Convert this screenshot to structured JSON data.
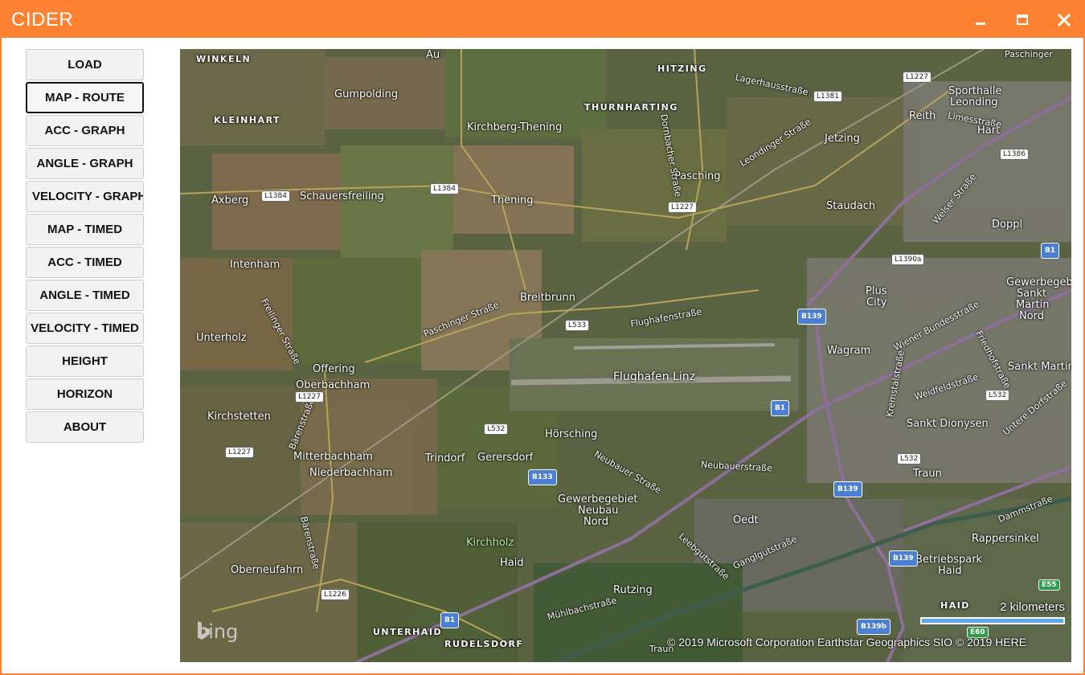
{
  "window": {
    "title": "CIDER",
    "accent": "#ff8232",
    "minimize_icon": "minimize-icon",
    "maximize_icon": "maximize-icon",
    "close_icon": "close-icon"
  },
  "sidebar": {
    "items": [
      {
        "label": "LOAD"
      },
      {
        "label": "MAP - ROUTE",
        "active": true
      },
      {
        "label": "ACC - GRAPH"
      },
      {
        "label": "ANGLE - GRAPH"
      },
      {
        "label": "VELOCITY - GRAPH"
      },
      {
        "label": "MAP - TIMED"
      },
      {
        "label": "ACC - TIMED"
      },
      {
        "label": "ANGLE - TIMED"
      },
      {
        "label": "VELOCITY - TIMED"
      },
      {
        "label": "HEIGHT"
      },
      {
        "label": "HORIZON"
      },
      {
        "label": "ABOUT"
      }
    ]
  },
  "map": {
    "places": {
      "winkeln": "WINKELN",
      "au": "Au",
      "hitzing": "HITZING",
      "paschinger": "Paschinger",
      "gumpolding": "Gumpolding",
      "thurnharting": "THURNHARTING",
      "sporthalle": "Sporthalle",
      "leonding": "Leonding",
      "kleinhart": "KLEINHART",
      "kirchberg": "Kirchberg-Thening",
      "reith": "Reith",
      "hart": "Hart",
      "jetzing": "Jetzing",
      "pasching": "Pasching",
      "axberg": "Axberg",
      "schauersfreiling": "Schauersfreiling",
      "thening": "Thening",
      "staudach": "Staudach",
      "doppl": "Doppl",
      "intenham": "Intenham",
      "plus_city_1": "Plus",
      "plus_city_2": "City",
      "gewerbe1": "Gewerbegebiet",
      "gewerbe2": "Sankt",
      "gewerbe3": "Martin",
      "gewerbe4": "Nord",
      "breitbrunn": "Breitbrunn",
      "unterholz": "Unterholz",
      "wagram": "Wagram",
      "flughafen": "Flughafen Linz",
      "sankt_martin": "Sankt Martin",
      "offering": "Offering",
      "oberbachham": "Oberbachham",
      "kirchstetten": "Kirchstetten",
      "sankt_dionysen": "Sankt Dionysen",
      "horsching": "Hörsching",
      "mitterbachham": "Mitterbachham",
      "niederbachham": "Niederbachham",
      "trindorf": "Trindorf",
      "gerersdorf": "Gerersdorf",
      "traun": "Traun",
      "gewerbe_neubau1": "Gewerbegebiet",
      "gewerbe_neubau2": "Neubau",
      "gewerbe_neubau3": "Nord",
      "oedt": "Oedt",
      "kirchholz": "Kirchholz",
      "rappersinkel": "Rappersinkel",
      "haid": "Haid",
      "betriebspark1": "Betriebspark",
      "betriebspark2": "Haid",
      "oberneufahrn": "Oberneufahrn",
      "rutzing": "Rutzing",
      "haid_caps": "HAID",
      "unterhaid": "UNTERHAID",
      "rudelsdorf": "RUDELSDORF",
      "traun_river": "Traun"
    },
    "streets": {
      "lagerhaus": "Lagerhausstraße",
      "leondinger": "Leondinger Straße",
      "dornbacher": "Dornbacher Straße",
      "limesstrasse": "Limesstraße",
      "welser": "Welser Straße",
      "paschinger_str": "Paschinger Straße",
      "flughafenstrasse": "Flughafenstraße",
      "freilinger": "Freilinger Straße",
      "wiener": "Wiener Bundesstraße",
      "friedhof": "Friedhofstraße",
      "kremstal": "Kremstalstraße",
      "weidfeld": "Weidfeldstraße",
      "untere_dorf": "Untere Dorfstraße",
      "baerenstrasse": "Bärenstraße",
      "neubauer": "Neubauer Straße",
      "neubauerstrasse": "Neubauerstraße",
      "baerenstrasse2": "Bärenstraße",
      "leebgut": "Leebgutstraße",
      "ganglgut": "Ganglgutstraße",
      "dammstrasse": "Dammstraße",
      "muehlbach": "Mühlbachstraße"
    },
    "shields": {
      "l1227a": "L1227",
      "l1381": "L1381",
      "l1386": "L1386",
      "l1384a": "L1384",
      "l1384b": "L1384",
      "l1227b": "L1227",
      "l1390a": "L1390a",
      "b1a": "B1",
      "b139a": "B139",
      "l533": "L533",
      "l1227c": "L1227",
      "b1b": "B1",
      "l532a": "L532",
      "l532b": "L532",
      "l532c": "L532",
      "l1227d": "L1227",
      "b133": "B133",
      "b139b": "B139",
      "b139c": "B139",
      "e55": "E55",
      "l1226": "L1226",
      "b1c": "B1",
      "b139b2": "B139b",
      "e60": "E60"
    },
    "scale_label": "2 kilometers",
    "copyright": "© 2019 Microsoft Corporation    Earthstar Geographics  SIO    © 2019 HERE",
    "logo_text": "bing"
  }
}
